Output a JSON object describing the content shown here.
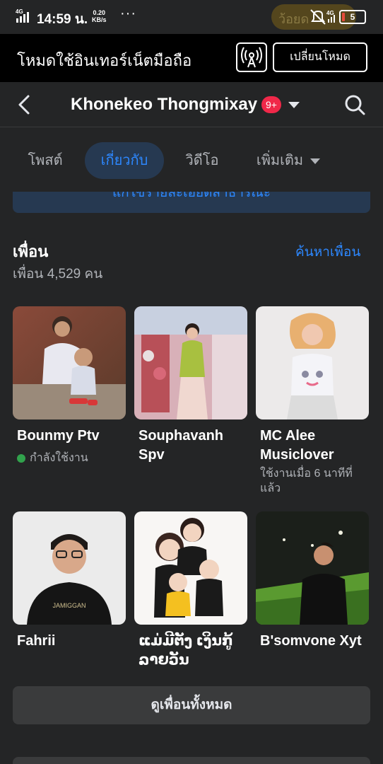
{
  "status_bar": {
    "network": "4G",
    "time": "14:59 น.",
    "speed_value": "0.20",
    "speed_unit": "KB/s",
    "pill_text": "ว้อยด",
    "right_network": "4G",
    "battery": "5"
  },
  "mode_bar": {
    "title": "โหมดใช้อินเทอร์เน็ตมือถือ",
    "switch_label": "เปลี่ยนโหมด"
  },
  "header": {
    "name": "Khonekeo Thongmixay",
    "badge": "9+"
  },
  "tabs": [
    {
      "label": "โพสต์",
      "active": false
    },
    {
      "label": "เกี่ยวกับ",
      "active": true
    },
    {
      "label": "วิดีโอ",
      "active": false
    },
    {
      "label": "เพิ่มเติม",
      "active": false
    }
  ],
  "edit_banner": "แก้ไขรายละเอียดสาธารณะ",
  "friends": {
    "title": "เพื่อน",
    "count": "เพื่อน 4,529 คน",
    "find_label": "ค้นหาเพื่อน",
    "items": [
      {
        "name": "Bounmy Ptv",
        "status": "กำลังใช้งาน",
        "online": true
      },
      {
        "name": "Souphavanh Spv",
        "status": "",
        "online": false
      },
      {
        "name": "MC Alee Musiclover",
        "status": "ใช้งานเมื่อ 6 นาทีที่แล้ว",
        "online": false
      },
      {
        "name": "Fahrii",
        "status": "",
        "online": false
      },
      {
        "name": "ແມ່ມີຕັງ ເງິນກູ້ ລາຍວັນ",
        "status": "",
        "online": false
      },
      {
        "name": "B'somvone Xyt",
        "status": "",
        "online": false
      }
    ],
    "see_all_label": "ดูเพื่อนทั้งหมด"
  },
  "colors": {
    "background": "#242526",
    "accent": "#2d88ff",
    "active_tab_bg": "#263951",
    "online": "#31a24c",
    "badge": "#f02849"
  }
}
